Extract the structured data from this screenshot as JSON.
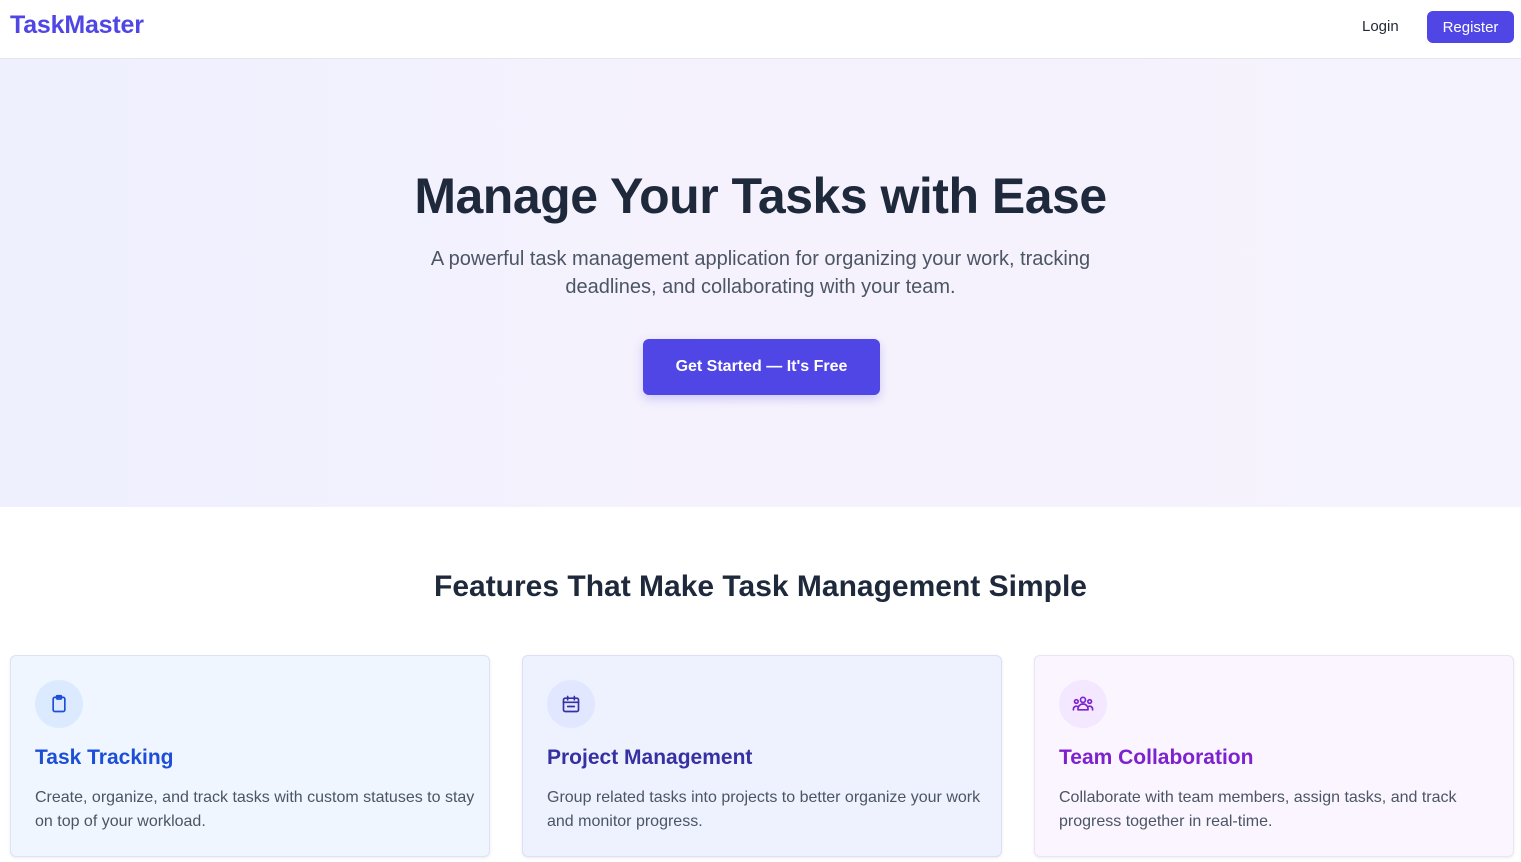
{
  "nav": {
    "brand": "TaskMaster",
    "login": "Login",
    "register": "Register"
  },
  "hero": {
    "title": "Manage Your Tasks with Ease",
    "subtitle": "A powerful task management application for organizing your work, tracking deadlines, and collaborating with your team.",
    "cta": "Get Started — It's Free"
  },
  "features": {
    "heading": "Features That Make Task Management Simple",
    "cards": [
      {
        "icon": "clipboard-icon",
        "title": "Task Tracking",
        "description": "Create, organize, and track tasks with custom statuses to stay on top of your workload."
      },
      {
        "icon": "calendar-icon",
        "title": "Project Management",
        "description": "Group related tasks into projects to better organize your work and monitor progress."
      },
      {
        "icon": "users-icon",
        "title": "Team Collaboration",
        "description": "Collaborate with team members, assign tasks, and track progress together in real-time."
      }
    ]
  },
  "colors": {
    "primary": "#4f46e5",
    "heading": "#1e293b",
    "card1_title": "#1d4ed8",
    "card2_title": "#3730a3",
    "card3_title": "#7e22ce"
  }
}
